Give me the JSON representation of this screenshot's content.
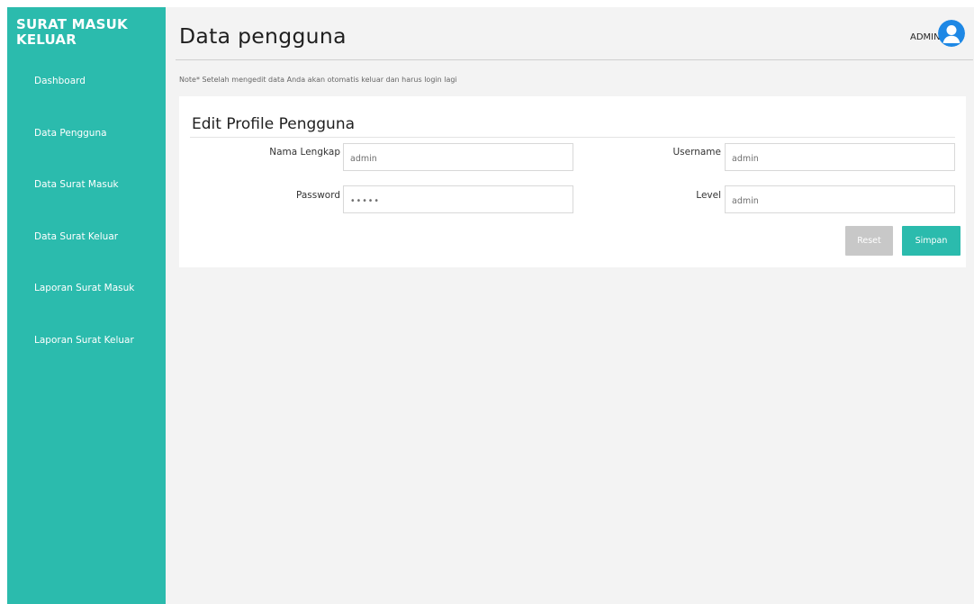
{
  "brand": {
    "line1": "SURAT MASUK",
    "line2": "KELUAR"
  },
  "sidebar": {
    "items": [
      {
        "label": "Dashboard"
      },
      {
        "label": "Data Pengguna"
      },
      {
        "label": "Data Surat Masuk"
      },
      {
        "label": "Data Surat Keluar"
      },
      {
        "label": "Laporan Surat Masuk"
      },
      {
        "label": "Laporan Surat Keluar"
      }
    ]
  },
  "header": {
    "title": "Data pengguna",
    "user": "ADMIN",
    "avatar_icon": "user-circle-icon"
  },
  "note": "Note* Setelah mengedit data Anda akan otomatis keluar dan harus login lagi",
  "form": {
    "title": "Edit Profile Pengguna",
    "nama_label": "Nama Lengkap",
    "nama_value": "admin",
    "username_label": "Username",
    "username_value": "admin",
    "password_label": "Password",
    "password_value": "•••••",
    "level_label": "Level",
    "level_value": "admin",
    "reset_label": "Reset",
    "save_label": "Simpan"
  },
  "colors": {
    "accent": "#2bbbad",
    "avatar": "#1e88e5",
    "reset_button": "#c8c8c8",
    "content_background": "#f3f3f3"
  }
}
